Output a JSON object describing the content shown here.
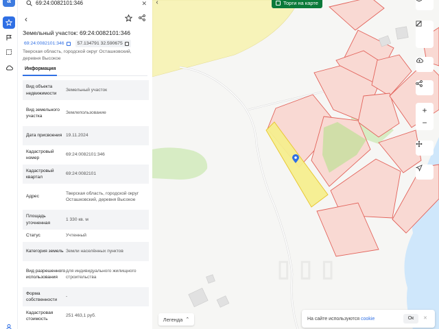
{
  "search": {
    "value": "69:24:0082101:346"
  },
  "card": {
    "title": "Земельный участок: 69:24:0082101:346",
    "cadastral_number": "69:24:0082101:346",
    "coords": "57.134791 32.590675",
    "address": "Тверская область, городской округ Осташковский, деревня Высокое",
    "tab": "Информация"
  },
  "rows": [
    {
      "k": "Вид объекта недвижимости",
      "v": "Земельный участок"
    },
    {
      "k": "Вид земельного участка",
      "v": "Землепользование"
    },
    {
      "k": "Дата присвоения",
      "v": "19.11.2024"
    },
    {
      "k": "Кадастровый номер",
      "v": "69:24:0082101:346"
    },
    {
      "k": "Кадастровый квартал",
      "v": "69:24:0082101"
    },
    {
      "k": "Адрес",
      "v": "Тверская область, городской округ Осташковский, деревня Высокое"
    },
    {
      "k": "Площадь уточненная",
      "v": "1 330 кв. м"
    },
    {
      "k": "Статус",
      "v": "Учтенный"
    },
    {
      "k": "Категория земель",
      "v": "Земли населённых пунктов"
    },
    {
      "k": "Вид разрешенного использования",
      "v": "для индивидуального жилищного строительства"
    },
    {
      "k": "Форма собственности",
      "v": "-"
    },
    {
      "k": "Кадастровая стоимость",
      "v": "251 463,1 руб."
    }
  ],
  "map": {
    "torgi_label": "Торги на карте",
    "legend_label": "Легенда",
    "cookie_text": "На сайте используются",
    "cookie_link": "cookie",
    "cookie_ok": "Ок"
  },
  "colors": {
    "accent": "#2f6fe4",
    "torgi": "#0b7a3a",
    "parcel_fill": "#f9d9d3",
    "parcel_stroke": "#e2625a",
    "selected_fill": "#f6ef8f",
    "water": "#cfe7fb",
    "forest": "#d7ecc4"
  }
}
